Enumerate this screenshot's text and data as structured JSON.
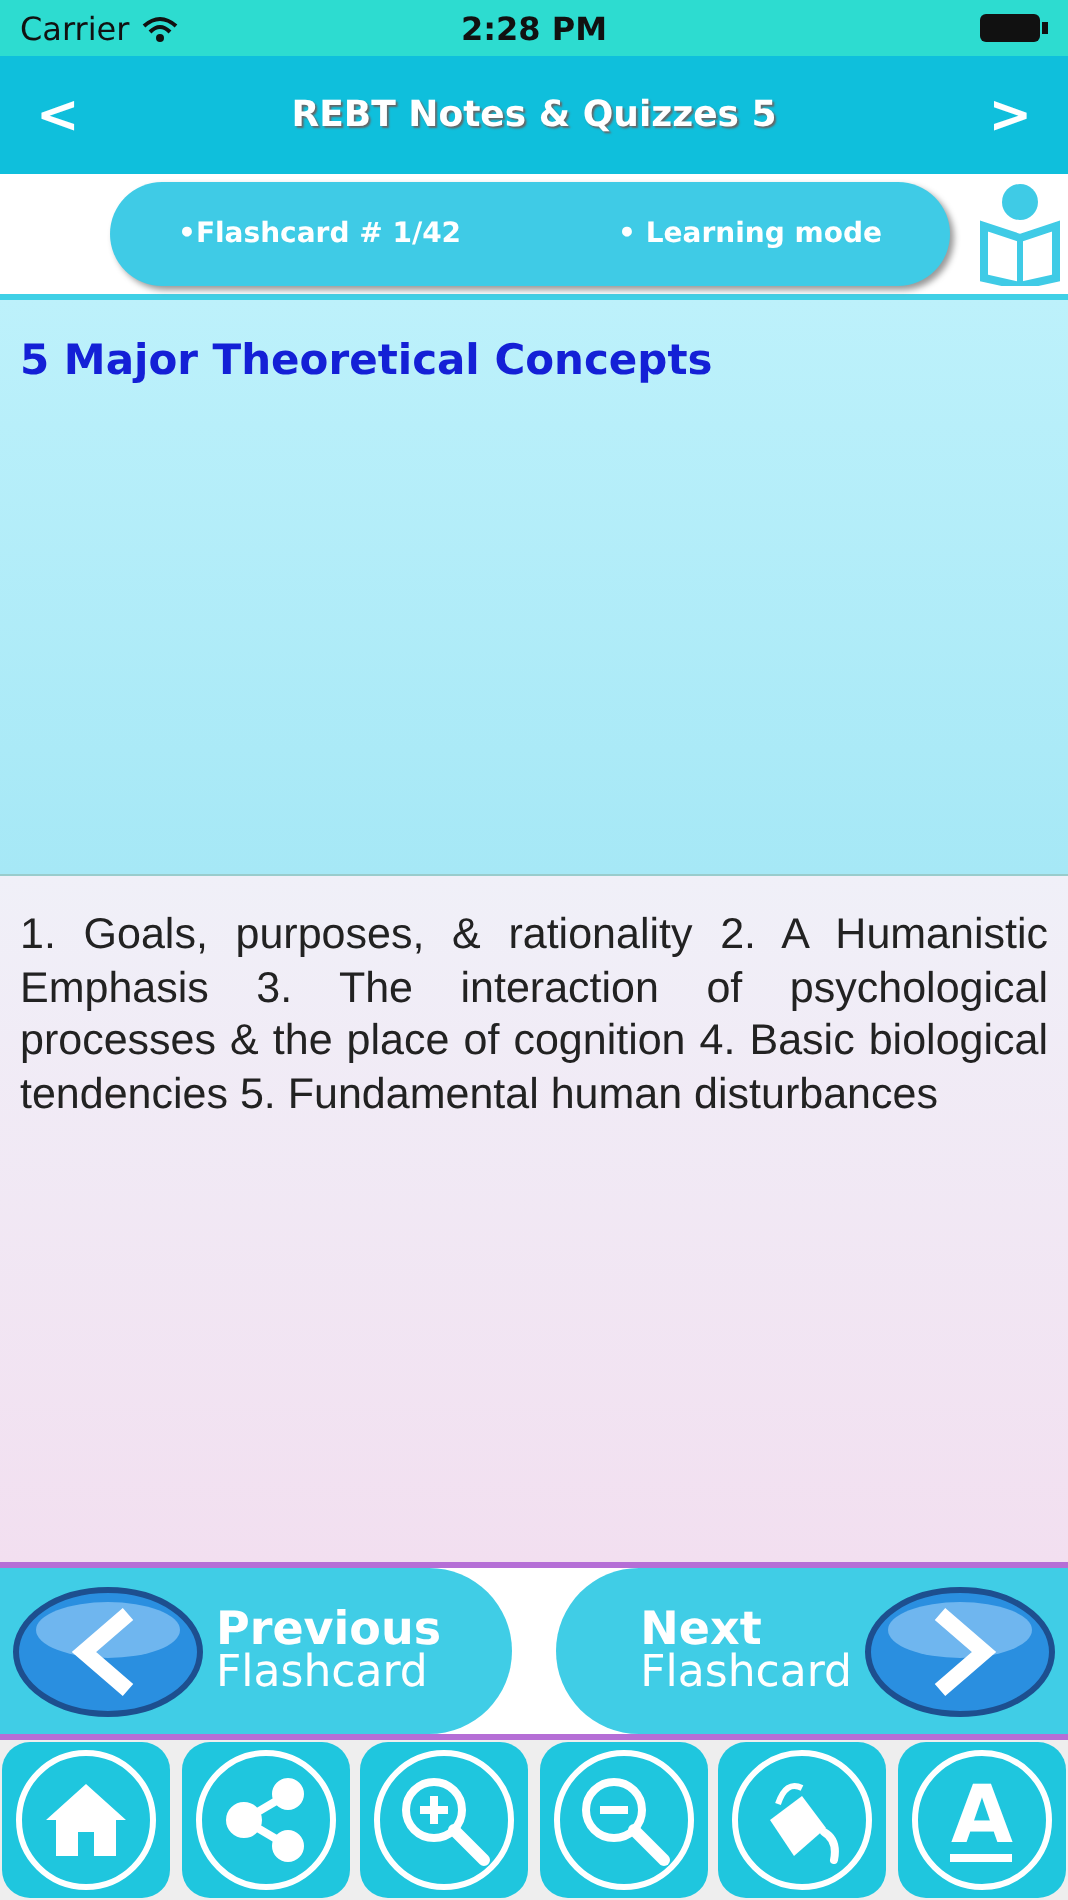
{
  "status_bar": {
    "carrier": "Carrier",
    "time": "2:28 PM"
  },
  "nav_bar": {
    "back": "<",
    "title": "REBT Notes & Quizzes 5",
    "forward": ">"
  },
  "info_bar": {
    "counter": "•Flashcard #  1/42",
    "mode": "• Learning mode"
  },
  "card": {
    "question": "5 Major Theoretical Concepts",
    "answer": "1. Goals, purposes, & rationality 2. A Humanistic Emphasis 3. The interaction of psychological processes & the place of cognition 4. Basic biological tendencies 5. Fundamental human disturbances"
  },
  "pager": [
    {
      "kind": "previous",
      "line_1": "Previous",
      "line_2": "Flashcard"
    },
    {
      "kind": "next",
      "line_1": "Next",
      "line_2": "Flashcard"
    }
  ],
  "toolbar": [
    {
      "kind": "home"
    },
    {
      "kind": "share"
    },
    {
      "kind": "zoom_in"
    },
    {
      "kind": "zoom_out"
    },
    {
      "kind": "paint"
    },
    {
      "kind": "font",
      "glyph": "A"
    }
  ]
}
